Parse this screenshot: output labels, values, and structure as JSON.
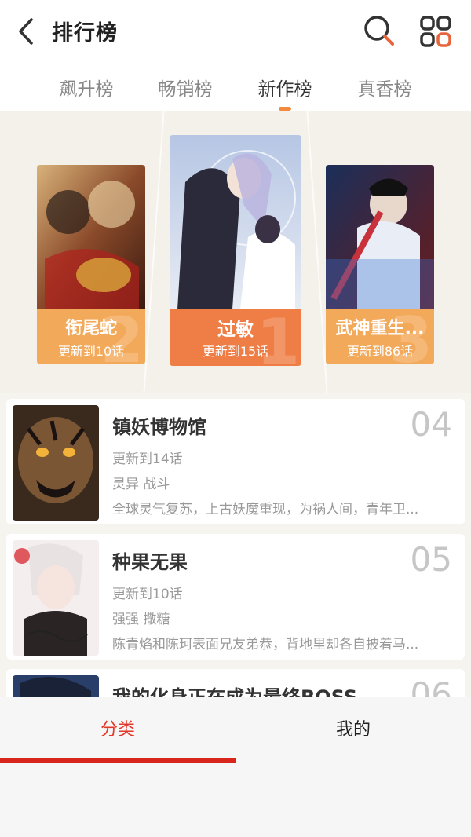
{
  "header": {
    "title": "排行榜"
  },
  "tabs": [
    {
      "label": "飙升榜"
    },
    {
      "label": "畅销榜"
    },
    {
      "label": "新作榜",
      "active": true
    },
    {
      "label": "真香榜"
    }
  ],
  "podium": [
    {
      "rank": "2",
      "title": "衔尾蛇",
      "update": "更新到10话"
    },
    {
      "rank": "1",
      "title": "过敏",
      "update": "更新到15话"
    },
    {
      "rank": "3",
      "title": "武神重生...",
      "update": "更新到86话"
    }
  ],
  "list": [
    {
      "rank": "04",
      "title": "镇妖博物馆",
      "update": "更新到14话",
      "tags": "灵异 战斗",
      "desc": "全球灵气复苏，上古妖魔重现，为祸人间，青年卫..."
    },
    {
      "rank": "05",
      "title": "种果无果",
      "update": "更新到10话",
      "tags": "强强 撒糖",
      "desc": "陈青焰和陈珂表面兄友弟恭，背地里却各自披着马..."
    },
    {
      "rank": "06",
      "title": "我的化身正在成为最终BOSS",
      "update": "",
      "tags": "",
      "desc": ""
    }
  ],
  "bottom_nav": [
    {
      "label": "分类",
      "active": true
    },
    {
      "label": "我的",
      "active": false
    }
  ],
  "colors": {
    "accent": "#e2392c",
    "podium_primary": "#ef7e46",
    "podium_secondary": "#f3a95a",
    "tab_indicator": "#f28b3d"
  }
}
